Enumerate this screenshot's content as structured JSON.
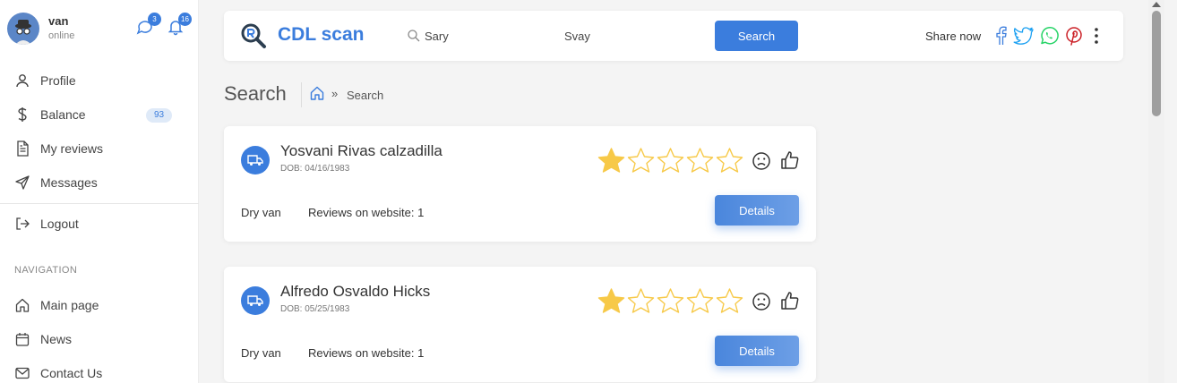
{
  "user": {
    "name": "van",
    "status": "online",
    "messages_count": "3",
    "notifications_count": "16"
  },
  "sidebar": {
    "items": [
      {
        "label": "Profile",
        "icon": "user-icon"
      },
      {
        "label": "Balance",
        "icon": "dollar-icon",
        "badge": "93"
      },
      {
        "label": "My reviews",
        "icon": "document-icon"
      },
      {
        "label": "Messages",
        "icon": "send-icon"
      },
      {
        "label": "Logout",
        "icon": "logout-icon"
      }
    ],
    "nav_heading": "NAVIGATION",
    "nav_items": [
      {
        "label": "Main page",
        "icon": "home-icon"
      },
      {
        "label": "News",
        "icon": "calendar-icon"
      },
      {
        "label": "Contact Us",
        "icon": "mail-icon"
      }
    ]
  },
  "header": {
    "brand": "CDL scan",
    "search_first": "Sary",
    "search_last": "Svay",
    "search_button": "Search",
    "share_label": "Share now"
  },
  "page": {
    "title": "Search",
    "breadcrumb_sep": "»",
    "breadcrumb_current": "Search"
  },
  "results": [
    {
      "name": "Yosvani Rivas calzadilla",
      "dob": "DOB: 04/16/1983",
      "type": "Dry van",
      "reviews": "Reviews on website: 1",
      "rating": 1,
      "button": "Details"
    },
    {
      "name": "Alfredo Osvaldo Hicks",
      "dob": "DOB: 05/25/1983",
      "type": "Dry van",
      "reviews": "Reviews on website: 1",
      "rating": 1,
      "button": "Details"
    }
  ],
  "colors": {
    "accent": "#3b7ddd",
    "star": "#f7c948",
    "facebook": "#3b5998",
    "twitter": "#1da1f2",
    "whatsapp": "#25d366",
    "pinterest": "#cb2027"
  }
}
